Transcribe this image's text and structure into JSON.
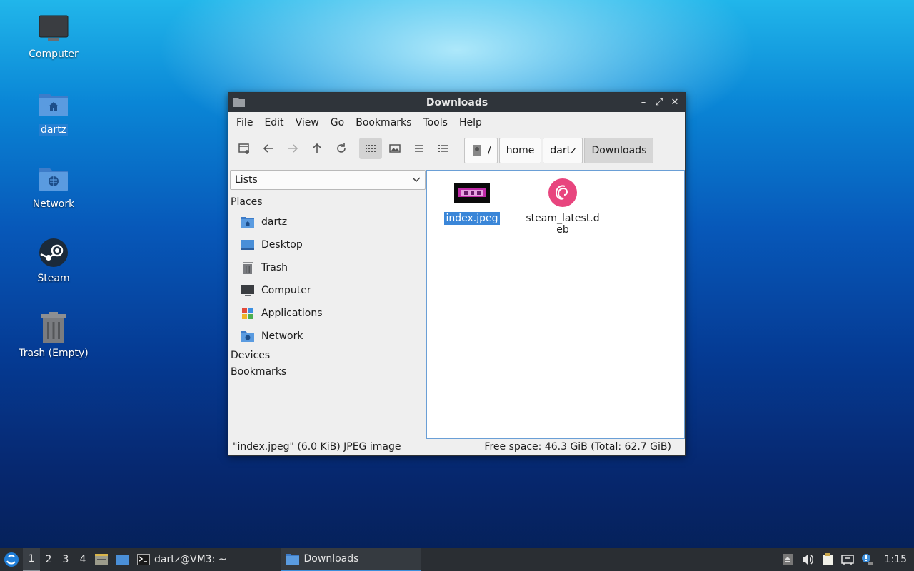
{
  "desktop": {
    "icons": [
      {
        "label": "Computer"
      },
      {
        "label": "dartz"
      },
      {
        "label": "Network"
      },
      {
        "label": "Steam"
      },
      {
        "label": "Trash (Empty)"
      }
    ]
  },
  "window": {
    "title": "Downloads",
    "controls": {
      "minimize": "–",
      "maximize": "⤢",
      "close": "✕"
    },
    "menu": [
      "File",
      "Edit",
      "View",
      "Go",
      "Bookmarks",
      "Tools",
      "Help"
    ],
    "breadcrumbs": {
      "root": "/",
      "items": [
        "home",
        "dartz",
        "Downloads"
      ]
    },
    "sidebar": {
      "selector": "Lists",
      "sections": {
        "places": "Places",
        "devices": "Devices",
        "bookmarks": "Bookmarks"
      },
      "places": [
        "dartz",
        "Desktop",
        "Trash",
        "Computer",
        "Applications",
        "Network"
      ]
    },
    "files": [
      {
        "name": "index.jpeg"
      },
      {
        "name": "steam_latest.deb"
      }
    ],
    "status": {
      "left": "\"index.jpeg\" (6.0 KiB) JPEG image",
      "right": "Free space: 46.3 GiB (Total: 62.7 GiB)"
    }
  },
  "taskbar": {
    "workspaces": [
      "1",
      "2",
      "3",
      "4"
    ],
    "apps": [
      {
        "label": "dartz@VM3: ~"
      },
      {
        "label": "Downloads"
      }
    ],
    "clock": "1:15"
  },
  "colors": {
    "titlebar": "#2f343a",
    "selection": "#3a86d8",
    "taskbar": "#2a2e33",
    "folder_blue": "#4a8fd8"
  }
}
